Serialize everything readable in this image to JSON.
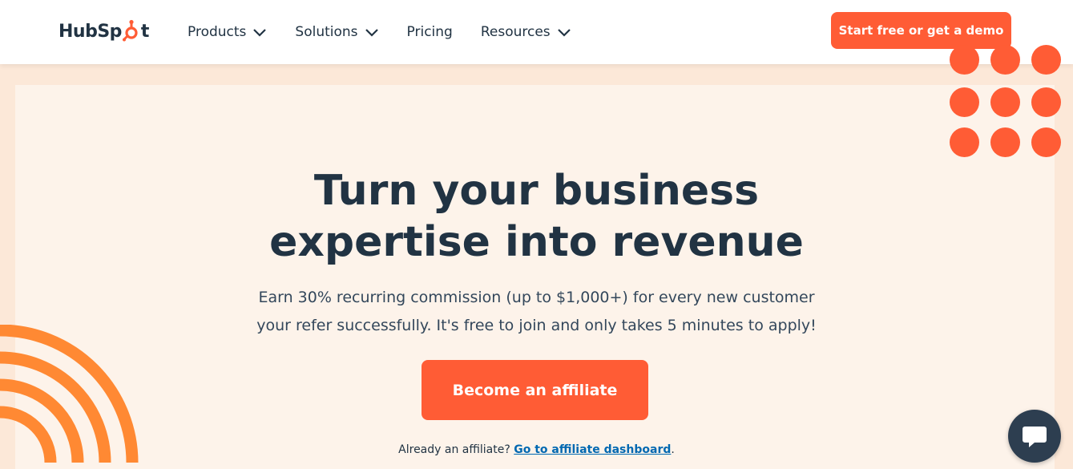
{
  "brand": {
    "name": "HubSpot",
    "accent_color": "#ff5c35",
    "text_color": "#213343",
    "link_color": "#0068b1"
  },
  "nav": {
    "items": [
      {
        "label": "Products",
        "has_dropdown": true
      },
      {
        "label": "Solutions",
        "has_dropdown": true
      },
      {
        "label": "Pricing",
        "has_dropdown": false
      },
      {
        "label": "Resources",
        "has_dropdown": true
      }
    ],
    "cta_label": "Start free or get a demo"
  },
  "hero": {
    "headline_line1": "Turn your business",
    "headline_line2": "expertise into revenue",
    "sub_line1": "Earn 30% recurring commission (up to $1,000+) for every new customer",
    "sub_line2": "your refer successfully. It's free to join and only takes 5 minutes to apply!",
    "cta_label": "Become an affiliate",
    "already_text": "Already an affiliate?",
    "dashboard_link": "Go to affiliate dashboard",
    "dashboard_suffix": "."
  },
  "icons": {
    "chat": "chat-bubble-icon",
    "chevron": "chevron-down-icon",
    "logo": "hubspot-sprocket-icon"
  }
}
